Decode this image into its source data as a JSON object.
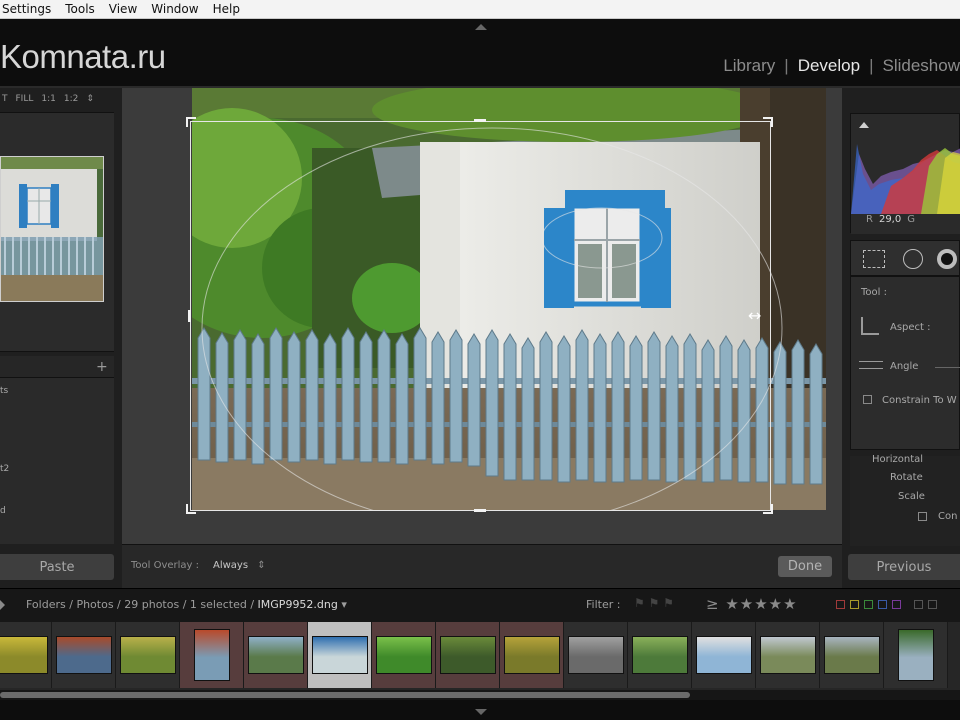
{
  "menubar": {
    "items": [
      "Settings",
      "Tools",
      "View",
      "Window",
      "Help"
    ]
  },
  "identity_plate": "Komnata.ru",
  "modules": {
    "library": "Library",
    "develop": "Develop",
    "slideshow": "Slideshow",
    "separator": "|"
  },
  "navigator": {
    "t_label": "T",
    "fill": "FILL",
    "one_to_one": "1:1",
    "ratio": "1:2",
    "arrows": "⇕"
  },
  "presets": {
    "items": [
      "ts",
      "",
      "",
      "",
      "t2",
      "",
      "d"
    ]
  },
  "buttons": {
    "paste": "Paste",
    "done": "Done",
    "previous": "Previous"
  },
  "toolbar": {
    "overlay_label": "Tool Overlay :",
    "overlay_value": "Always",
    "overlay_arrows": "⇕"
  },
  "histogram": {
    "r_label": "R",
    "r_value": "29,0",
    "g_label": "G"
  },
  "crop_panel": {
    "tool_label": "Tool :",
    "aspect_label": "Aspect :",
    "angle_label": "Angle",
    "constrain_label": "Constrain To W"
  },
  "transform_panel": {
    "horizontal": "Horizontal",
    "rotate": "Rotate",
    "scale": "Scale",
    "constrain": "Con"
  },
  "filmstrip": {
    "path_folders": "Folders",
    "path_photos": "Photos",
    "count": "29 photos",
    "selected": "1 selected",
    "current_file": "IMGP9952.dng",
    "caret": "▾",
    "filter_label": "Filter :",
    "stars": "≥ ★★★★★",
    "thumbnails": [
      {
        "bg": "#8c8a2a",
        "accent": "#c9b83a"
      },
      {
        "bg": "#4d6a8c",
        "accent": "#a84a2a"
      },
      {
        "bg": "#6f8a33",
        "accent": "#b9b04a"
      },
      {
        "bg": "#7a9cb5",
        "accent": "#b94a2a"
      },
      {
        "bg": "#5a7a4a",
        "accent": "#8fb0c8"
      },
      {
        "bg": "#c9d6d9",
        "accent": "#2f6fb0"
      },
      {
        "bg": "#3f8a2a",
        "accent": "#7ac04a"
      },
      {
        "bg": "#3d5a2a",
        "accent": "#6a8a3a"
      },
      {
        "bg": "#7a7a2a",
        "accent": "#b5a23a"
      },
      {
        "bg": "#6a6a6a",
        "accent": "#a0a0a0"
      },
      {
        "bg": "#4d7a3a",
        "accent": "#8ab05a"
      },
      {
        "bg": "#8fb5d6",
        "accent": "#e0e0e0"
      },
      {
        "bg": "#7a8a5a",
        "accent": "#c0c8d0"
      },
      {
        "bg": "#6a7a4a",
        "accent": "#a8b4c0"
      },
      {
        "bg": "#9ab0c0",
        "accent": "#3a6a2a"
      }
    ]
  },
  "colors": {
    "accent_blue": "#2f7fc1",
    "panel": "#1f1f1f",
    "center": "#3b3b3b"
  }
}
